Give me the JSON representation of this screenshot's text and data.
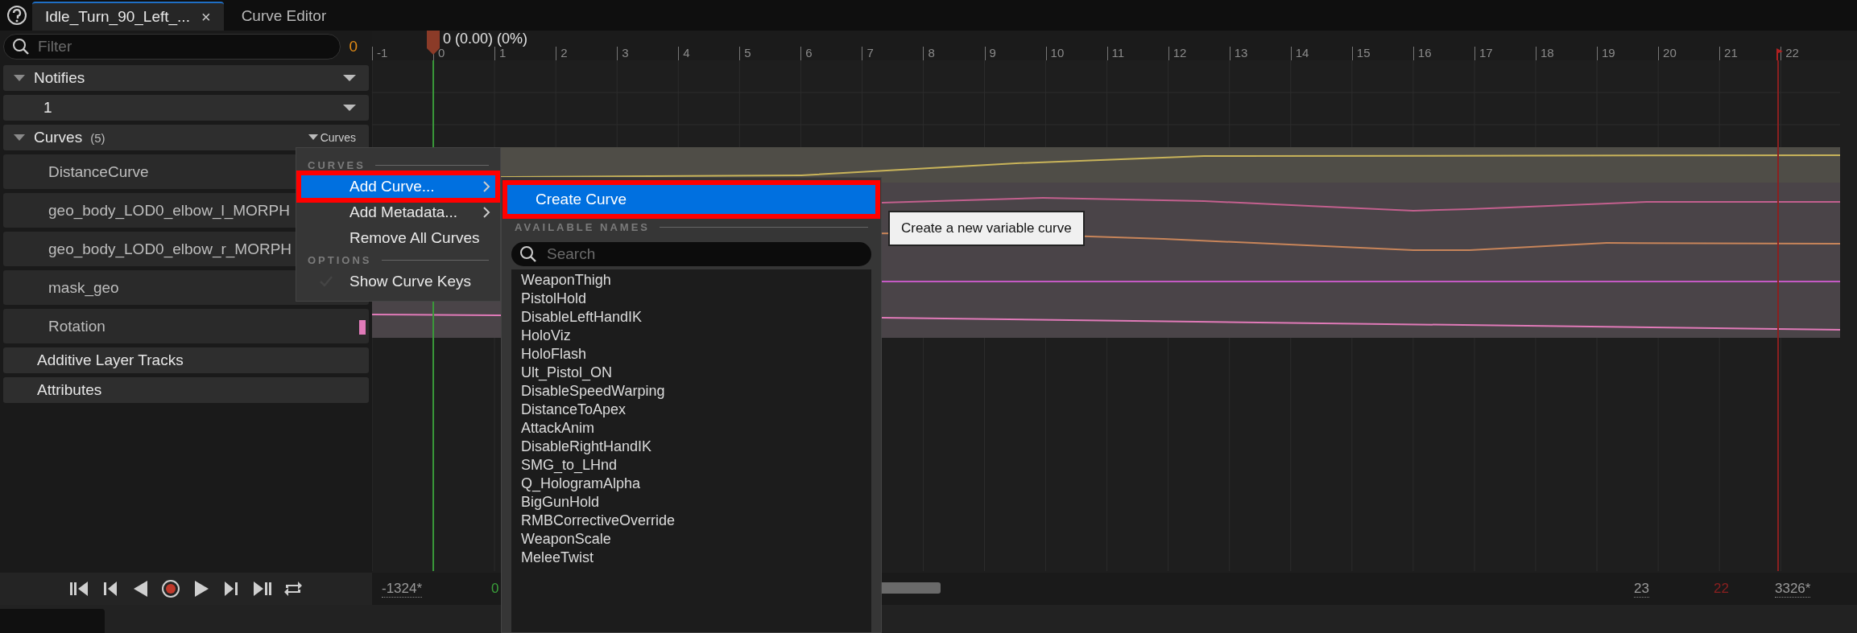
{
  "tabs": [
    {
      "label": "Idle_Turn_90_Left_...",
      "selected": true,
      "close": "×"
    },
    {
      "label": "Curve Editor",
      "selected": false
    }
  ],
  "filter": {
    "placeholder": "Filter",
    "count": "0"
  },
  "tracks": [
    {
      "kind": "group",
      "label": "Notifies",
      "expanded": true
    },
    {
      "kind": "notify",
      "label": "1"
    },
    {
      "kind": "group",
      "label": "Curves",
      "count": "(5)",
      "expanded": true,
      "button": "Curves"
    },
    {
      "kind": "curve",
      "label": "DistanceCurve",
      "color": "#c9b45a"
    },
    {
      "kind": "curve",
      "label": "geo_body_LOD0_elbow_l_MORPH",
      "color": "#c3608e"
    },
    {
      "kind": "curve",
      "label": "geo_body_LOD0_elbow_r_MORPH",
      "color": "#c8855a"
    },
    {
      "kind": "curve",
      "label": "mask_geo",
      "color": "#c45ac4"
    },
    {
      "kind": "curve",
      "label": "Rotation",
      "color": "#e07ab8",
      "swatch": true
    },
    {
      "kind": "section",
      "label": "Additive Layer Tracks"
    },
    {
      "kind": "section",
      "label": "Attributes"
    }
  ],
  "ruler": {
    "scrub_label": "0 (0.00) (0%)",
    "ticks": [
      "-1",
      "0",
      "1",
      "2",
      "3",
      "4",
      "5",
      "6",
      "7",
      "8",
      "9",
      "10",
      "11",
      "12",
      "13",
      "14",
      "15",
      "16",
      "17",
      "18",
      "19",
      "20",
      "21",
      "22"
    ]
  },
  "range_bar": {
    "start": "-1324*",
    "current": "0",
    "end_frame": "23",
    "end_marker": "22",
    "end": "3326*"
  },
  "context_menu": {
    "sections": [
      {
        "heading": "CURVES",
        "items": [
          {
            "label": "Add Curve...",
            "kind": "submenu",
            "selected": true,
            "outlined": true
          },
          {
            "label": "Add Metadata...",
            "kind": "submenu",
            "selected": false,
            "outlined": false
          },
          {
            "label": "Remove All Curves",
            "kind": "action",
            "selected": false,
            "outlined": false
          }
        ]
      },
      {
        "heading": "OPTIONS",
        "items": [
          {
            "label": "Show Curve Keys",
            "kind": "toggle",
            "checked": false,
            "selected": false,
            "outlined": false
          }
        ]
      }
    ]
  },
  "submenu": {
    "action": {
      "label": "Create Curve",
      "selected": true,
      "outlined": true
    },
    "heading": "AVAILABLE NAMES",
    "search": {
      "placeholder": "Search"
    },
    "names": [
      "WeaponThigh",
      "PistolHold",
      "DisableLeftHandIK",
      "HoloViz",
      "HoloFlash",
      "Ult_Pistol_ON",
      "DisableSpeedWarping",
      "DistanceToApex",
      "AttackAnim",
      "DisableRightHandIK",
      "SMG_to_LHnd",
      "Q_HologramAlpha",
      "BigGunHold",
      "RMBCorrectiveOverride",
      "WeaponScale",
      "MeleeTwist"
    ]
  },
  "tooltip": {
    "text": "Create a new variable curve"
  }
}
